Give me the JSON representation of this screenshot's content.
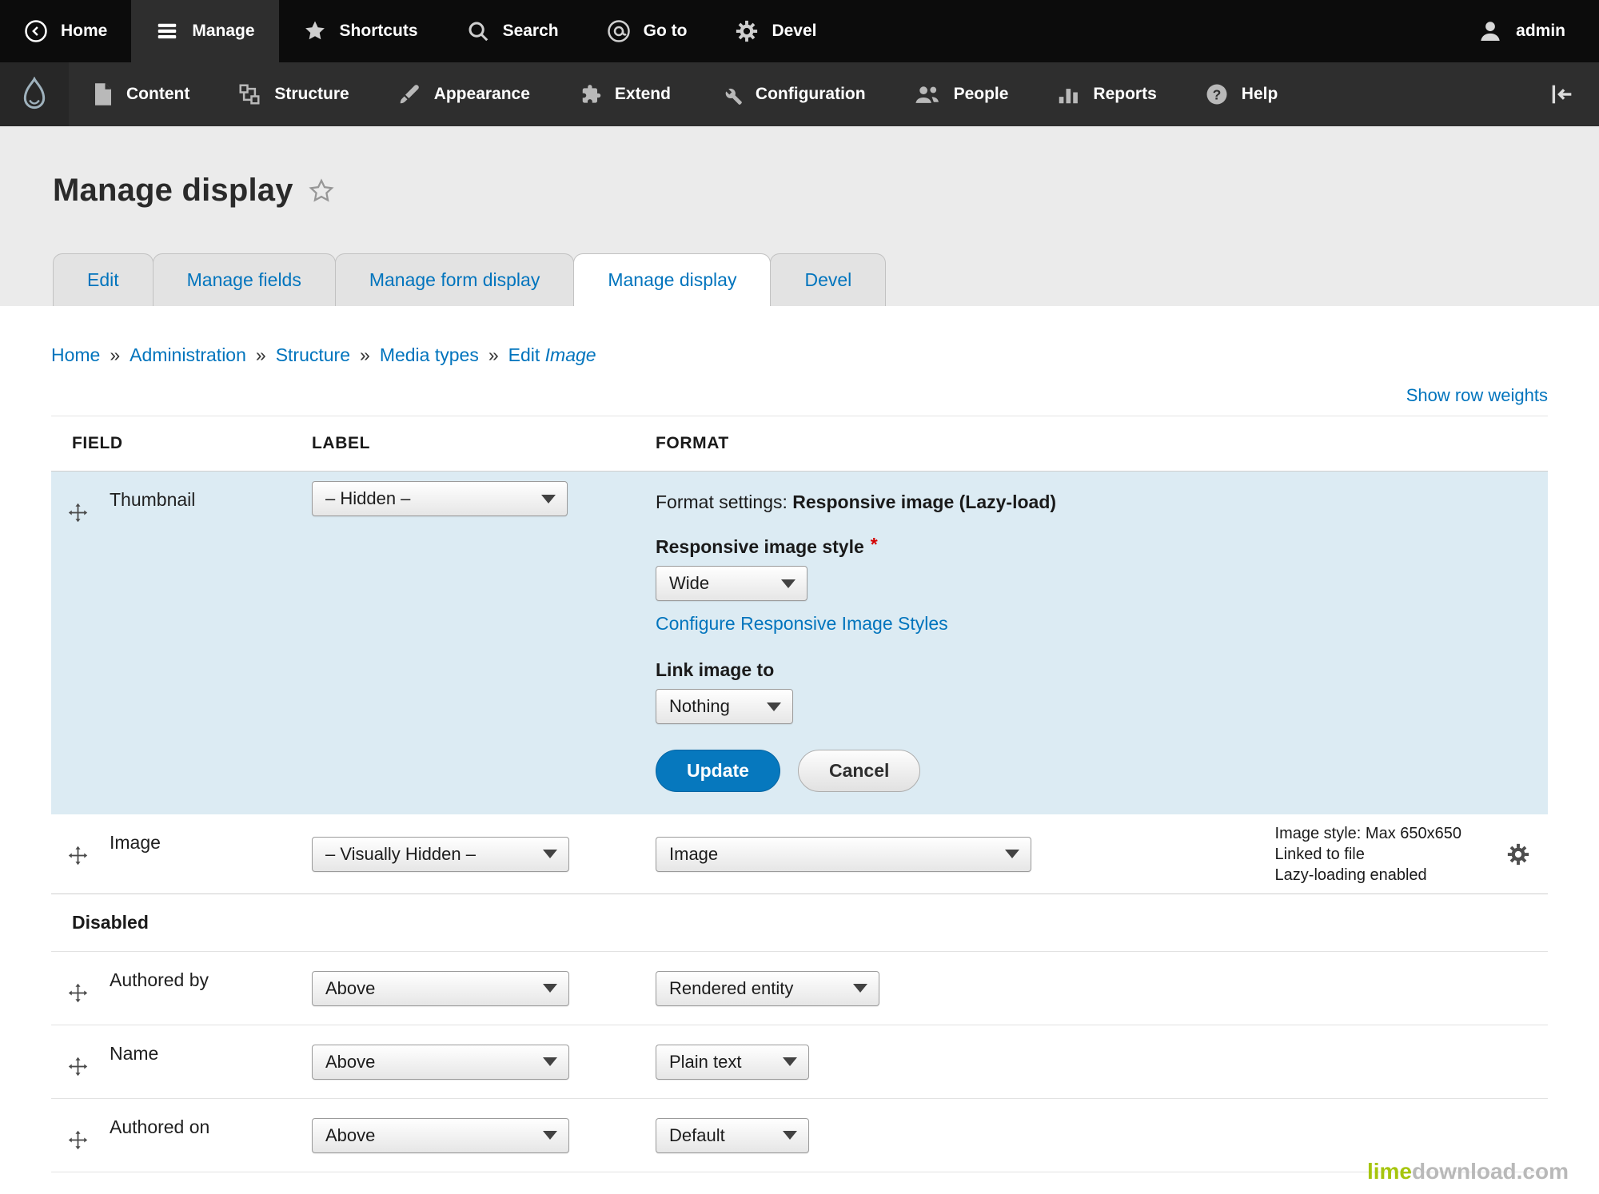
{
  "colors": {
    "toolbar_black": "#0c0c0c",
    "toolbar_gray": "#2e2e2e",
    "link_blue": "#0074bd",
    "accent_blue": "#0678be",
    "row_highlight": "#dcebf3",
    "required_red": "#d40000",
    "watermark_lime": "#a6c50e"
  },
  "toolbar_primary": {
    "items": [
      {
        "label": "Home"
      },
      {
        "label": "Manage"
      },
      {
        "label": "Shortcuts"
      },
      {
        "label": "Search"
      },
      {
        "label": "Go to"
      },
      {
        "label": "Devel"
      }
    ],
    "user": "admin"
  },
  "toolbar_secondary": {
    "items": [
      {
        "label": "Content"
      },
      {
        "label": "Structure"
      },
      {
        "label": "Appearance"
      },
      {
        "label": "Extend"
      },
      {
        "label": "Configuration"
      },
      {
        "label": "People"
      },
      {
        "label": "Reports"
      },
      {
        "label": "Help"
      }
    ]
  },
  "page": {
    "title": "Manage display"
  },
  "tabs": {
    "items": [
      {
        "label": "Edit"
      },
      {
        "label": "Manage fields"
      },
      {
        "label": "Manage form display"
      },
      {
        "label": "Manage display"
      },
      {
        "label": "Devel"
      }
    ]
  },
  "breadcrumb": {
    "separator": "»",
    "items": [
      {
        "label": "Home"
      },
      {
        "label": "Administration"
      },
      {
        "label": "Structure"
      },
      {
        "label": "Media types"
      }
    ],
    "current_prefix": "Edit",
    "current_em": "Image"
  },
  "table": {
    "show_row_weights": "Show row weights",
    "headers": {
      "field": "FIELD",
      "label": "LABEL",
      "format": "FORMAT"
    },
    "thumbnail_row": {
      "field": "Thumbnail",
      "label_value": "– Hidden –",
      "settings": {
        "summary_label": "Format settings:",
        "summary_value": "Responsive image (Lazy-load)",
        "style_label": "Responsive image style",
        "required": "*",
        "style_value": "Wide",
        "configure_link": "Configure Responsive Image Styles",
        "link_label": "Link image to",
        "link_value": "Nothing",
        "update": "Update",
        "cancel": "Cancel"
      }
    },
    "image_row": {
      "field": "Image",
      "label_value": "– Visually Hidden –",
      "format_value": "Image",
      "summary_lines": [
        "Image style: Max 650x650",
        "Linked to file",
        "Lazy-loading enabled"
      ]
    },
    "disabled_heading": "Disabled",
    "disabled_rows": [
      {
        "field": "Authored by",
        "label_value": "Above",
        "format_value": "Rendered entity"
      },
      {
        "field": "Name",
        "label_value": "Above",
        "format_value": "Plain text"
      },
      {
        "field": "Authored on",
        "label_value": "Above",
        "format_value": "Default"
      }
    ]
  },
  "watermark": {
    "lime": "lime",
    "rest": "download.com"
  }
}
